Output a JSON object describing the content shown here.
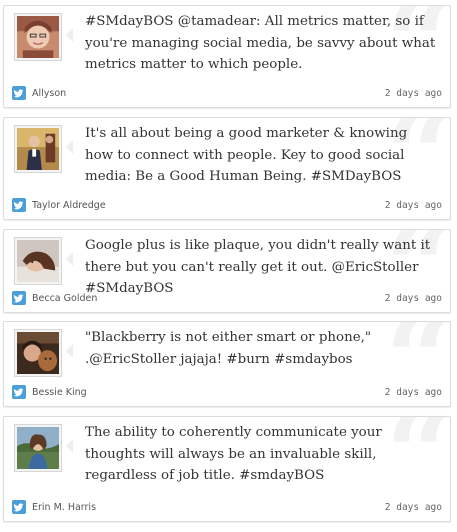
{
  "tweets": [
    {
      "text": "#SMdayBOS @tamadear: All metrics matter, so if you're managing social media, be savvy about what metrics matter to which people.",
      "author": "Allyson",
      "time": "2 days ago"
    },
    {
      "text": "It's all about being a good marketer & knowing how to connect with people. Key to good social media: Be a Good Human Being. #SMDayBOS",
      "author": "Taylor Aldredge",
      "time": "2 days ago"
    },
    {
      "text": "Google plus is like plaque, you didn't really want it there but you can't really get it out. @EricStoller #SMdayBOS",
      "author": "Becca Golden",
      "time": "2 days ago"
    },
    {
      "text": "\"Blackberry is not either smart or phone,\" .@EricStoller jajaja! #burn #smdaybos",
      "author": "Bessie King",
      "time": "2 days ago"
    },
    {
      "text": "The ability to coherently communicate your thoughts will always be an invaluable skill, regardless of job title. #smdayBOS",
      "author": "Erin M. Harris",
      "time": "2 days ago"
    }
  ],
  "quote_glyph": "“",
  "icons": {
    "source": "twitter-bird-icon",
    "avatar": "user-photo"
  },
  "colors": {
    "twitter_blue": "#4a9fd8",
    "text": "#333333",
    "border": "#dcdcdc"
  }
}
